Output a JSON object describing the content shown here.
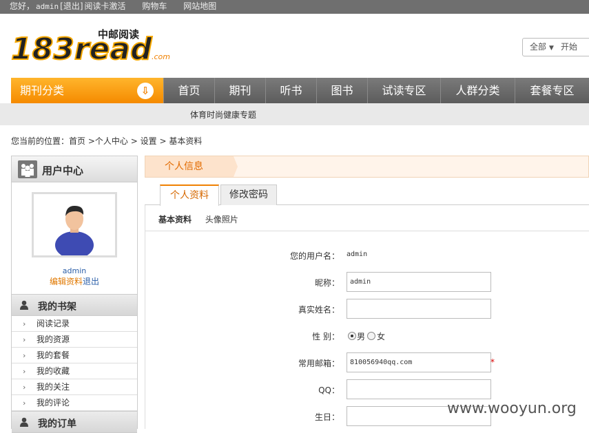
{
  "topbar": {
    "greeting": "您好，",
    "username": "admin",
    "logout": "[退出]",
    "activate": "阅读卡激活",
    "cart": "购物车",
    "sitemap": "网站地图"
  },
  "logo": {
    "text": "183read",
    "tagline": "中邮阅读",
    "suffix": ".com"
  },
  "search": {
    "scope": "全部",
    "button": "开始"
  },
  "nav": {
    "category": "期刊分类",
    "items": [
      "首页",
      "期刊",
      "听书",
      "图书",
      "试读专区",
      "人群分类",
      "套餐专区"
    ]
  },
  "subnav": {
    "text": "体育时尚健康专题"
  },
  "breadcrumb": {
    "prefix": "您当前的位置：",
    "items": [
      "首页",
      "个人中心",
      "设置",
      "基本资料"
    ],
    "sep": " > ",
    "sep2": " >"
  },
  "sidebar": {
    "title": "用户中心",
    "username": "admin",
    "edit_label": "编辑资料",
    "logout_label": "退出",
    "bookshelf_title": "我的书架",
    "bookshelf_items": [
      "阅读记录",
      "我的资源",
      "我的套餐",
      "我的收藏",
      "我的关注",
      "我的评论"
    ],
    "orders_title": "我的订单"
  },
  "main": {
    "section_title": "个人信息",
    "tabs": [
      "个人资料",
      "修改密码"
    ],
    "subtabs": [
      "基本资料",
      "头像照片"
    ],
    "form": {
      "username_label": "您的用户名：",
      "username_value": "admin",
      "nickname_label": "昵称：",
      "nickname_value": "admin",
      "realname_label": "真实姓名：",
      "realname_value": "",
      "gender_label": "性 别：",
      "gender_male": "男",
      "gender_female": "女",
      "gender_selected": "男",
      "email_label": "常用邮箱：",
      "email_value": "810056940qq.com",
      "required_mark": "*",
      "qq_label": "QQ：",
      "qq_value": "",
      "birthday_label": "生日：",
      "birthday_value": ""
    }
  },
  "watermark": "www.wooyun.org",
  "colors": {
    "accent": "#f58a00",
    "nav": "#6a6a6a",
    "link": "#2a5ea8"
  }
}
